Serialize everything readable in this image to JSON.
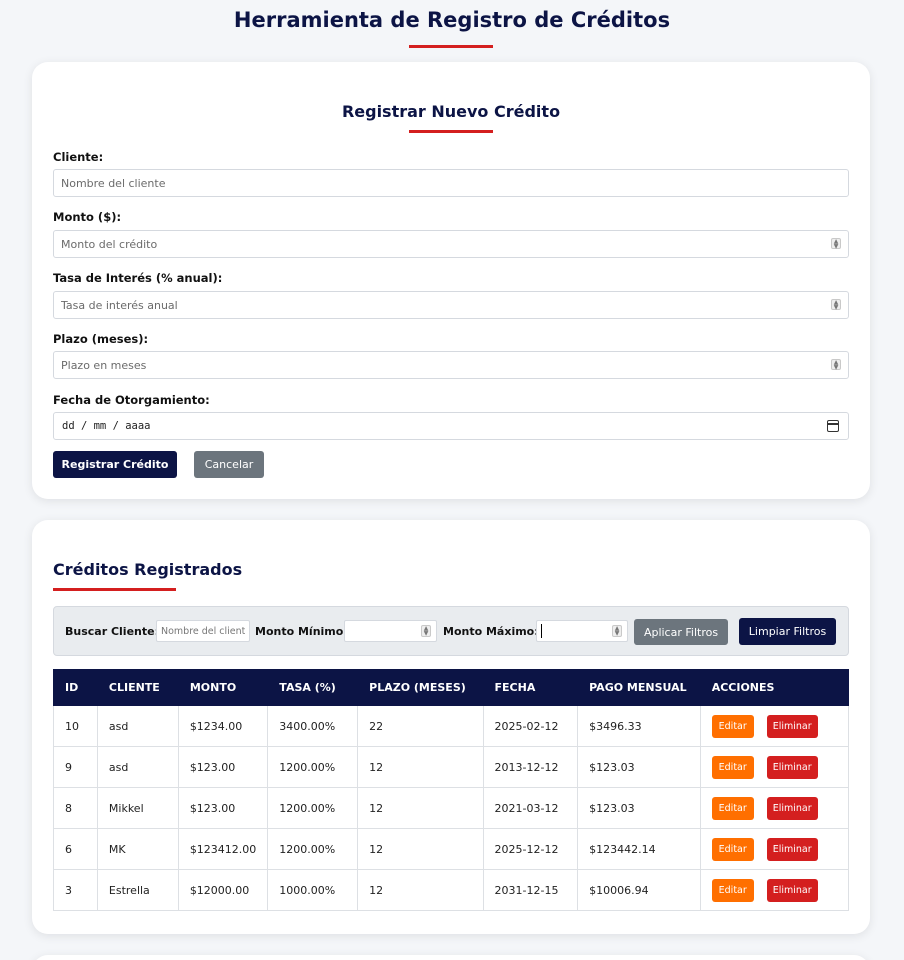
{
  "page_title": "Herramienta de Registro de Créditos",
  "form": {
    "title": "Registrar Nuevo Crédito",
    "cliente_label": "Cliente:",
    "cliente_placeholder": "Nombre del cliente",
    "monto_label": "Monto ($):",
    "monto_placeholder": "Monto del crédito",
    "tasa_label": "Tasa de Interés (% anual):",
    "tasa_placeholder": "Tasa de interés anual",
    "plazo_label": "Plazo (meses):",
    "plazo_placeholder": "Plazo en meses",
    "fecha_label": "Fecha de Otorgamiento:",
    "fecha_value": "dd / mm / aaaa",
    "register_button": "Registrar Crédito",
    "cancel_button": "Cancelar"
  },
  "list": {
    "title": "Créditos Registrados",
    "filters": {
      "search_label": "Buscar Cliente:",
      "search_placeholder": "Nombre del cliente",
      "min_label": "Monto Mínimo:",
      "max_label": "Monto Máximo:",
      "apply_button": "Aplicar Filtros",
      "clear_button": "Limpiar Filtros"
    },
    "columns": [
      "ID",
      "CLIENTE",
      "MONTO",
      "TASA (%)",
      "PLAZO (MESES)",
      "FECHA",
      "PAGO MENSUAL",
      "ACCIONES"
    ],
    "rows": [
      {
        "id": "10",
        "cliente": "asd",
        "monto": "$1234.00",
        "tasa": "3400.00%",
        "plazo": "22",
        "fecha": "2025-02-12",
        "pago": "$3496.33"
      },
      {
        "id": "9",
        "cliente": "asd",
        "monto": "$123.00",
        "tasa": "1200.00%",
        "plazo": "12",
        "fecha": "2013-12-12",
        "pago": "$123.03"
      },
      {
        "id": "8",
        "cliente": "Mikkel",
        "monto": "$123.00",
        "tasa": "1200.00%",
        "plazo": "12",
        "fecha": "2021-03-12",
        "pago": "$123.03"
      },
      {
        "id": "6",
        "cliente": "MK",
        "monto": "$123412.00",
        "tasa": "1200.00%",
        "plazo": "12",
        "fecha": "2025-12-12",
        "pago": "$123442.14"
      },
      {
        "id": "3",
        "cliente": "Estrella",
        "monto": "$12000.00",
        "tasa": "1000.00%",
        "plazo": "12",
        "fecha": "2031-12-15",
        "pago": "$10006.94"
      }
    ],
    "edit_label": "Editar",
    "delete_label": "Eliminar"
  },
  "colors": {
    "primary": "#0c1445",
    "accent": "#d41f1f",
    "secondary": "#6c757d",
    "edit": "#ff6f00"
  }
}
